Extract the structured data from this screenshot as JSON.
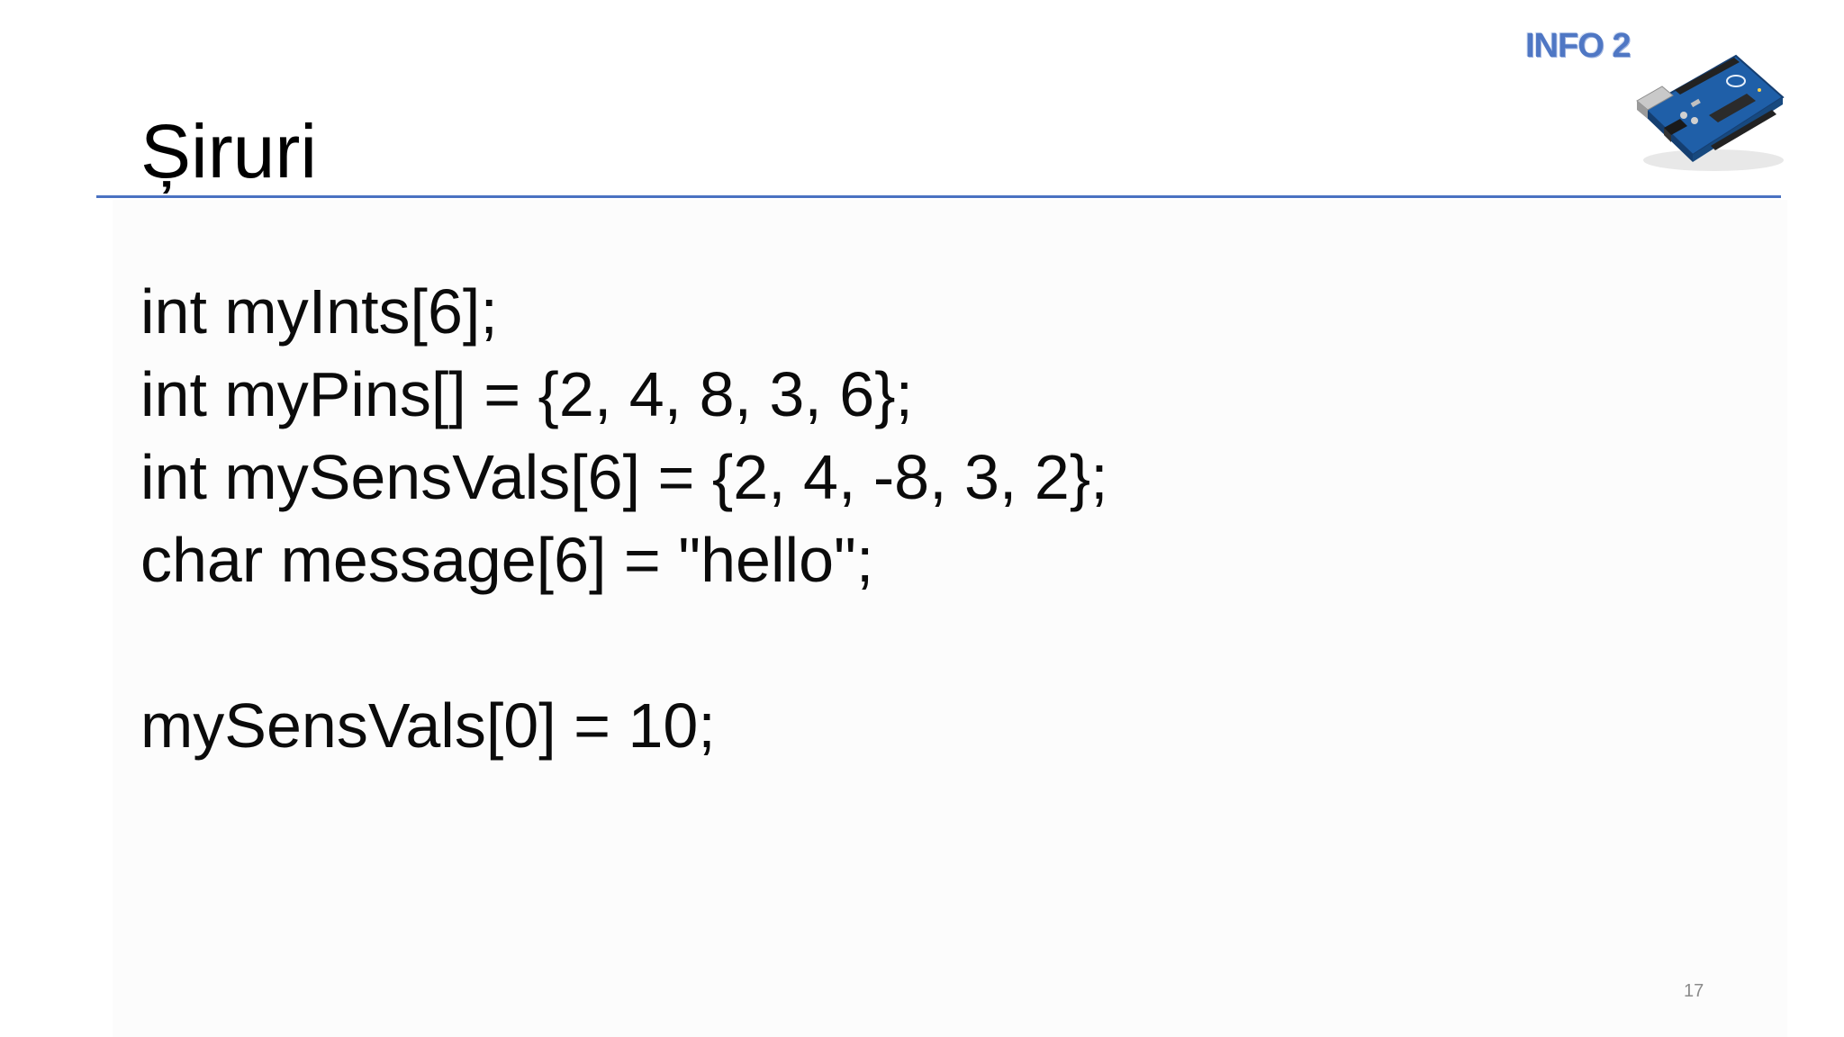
{
  "slide": {
    "badge": "INFO 2",
    "title": "Șiruri",
    "page_number": "17",
    "accent_color": "#4a72c2",
    "badge_color": "#4f77c4"
  },
  "code": {
    "lines": [
      "int myInts[6];",
      "int myPins[] = {2, 4, 8, 3, 6};",
      "int mySensVals[6] = {2, 4, -8, 3, 2};",
      "char message[6] = \"hello\";",
      "",
      "mySensVals[0] = 10;"
    ]
  },
  "image": {
    "subject": "arduino-board-photo"
  }
}
